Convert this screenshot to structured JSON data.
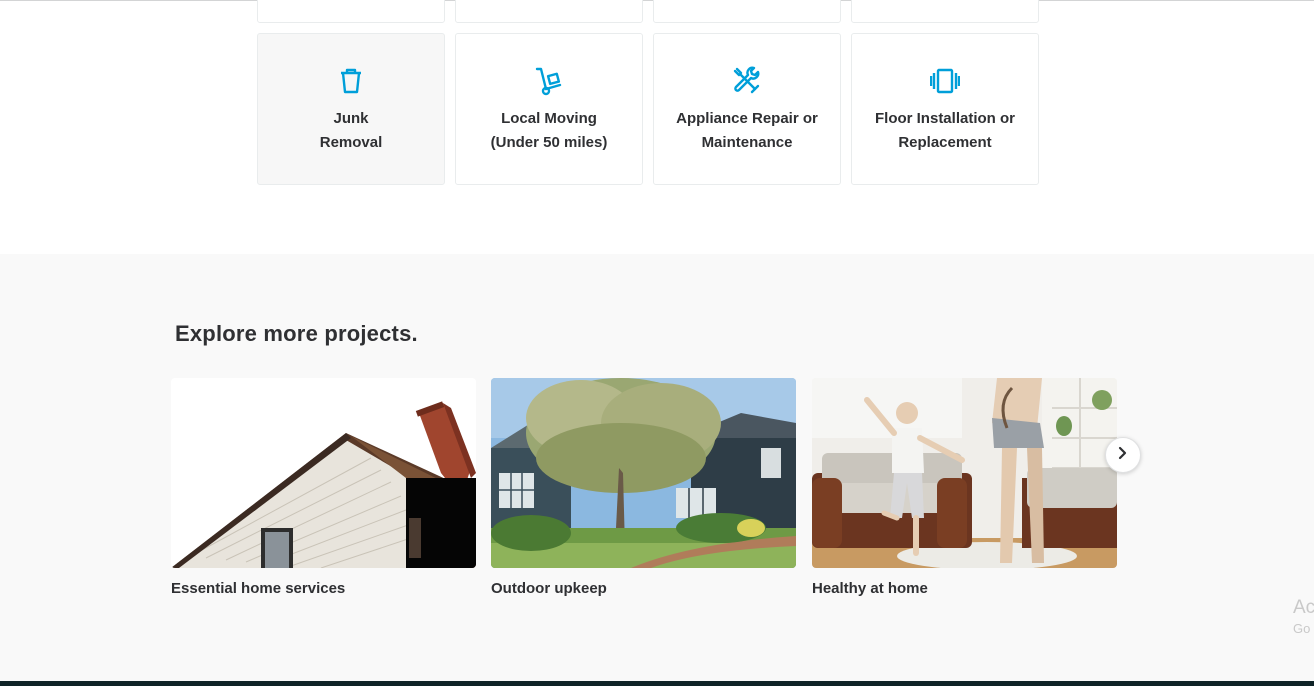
{
  "categories": [
    {
      "label": "Junk\nRemoval",
      "icon": "trash-can-icon"
    },
    {
      "label": "Local Moving\n(Under 50 miles)",
      "icon": "hand-truck-icon"
    },
    {
      "label": "Appliance Repair or\nMaintenance",
      "icon": "wrench-screwdriver-icon"
    },
    {
      "label": "Floor Installation or\nReplacement",
      "icon": "floor-panels-icon"
    }
  ],
  "explore": {
    "title": "Explore more projects.",
    "projects": [
      {
        "caption": "Essential home services",
        "image": "house-siding-photo"
      },
      {
        "caption": "Outdoor upkeep",
        "image": "front-yard-tree-photo"
      },
      {
        "caption": "Healthy at home",
        "image": "child-exercising-living-room-photo"
      }
    ],
    "next_icon": "chevron-right-icon"
  },
  "watermark": {
    "line1": "Ac",
    "line2": "Go"
  },
  "colors": {
    "accent": "#009fd9",
    "text": "#2f3033",
    "section_bg": "#f9f9f9",
    "footer": "#0f2327"
  }
}
